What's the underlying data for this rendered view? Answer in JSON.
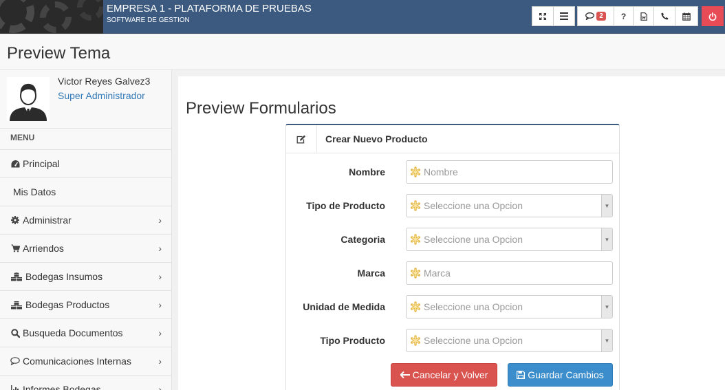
{
  "header": {
    "company_title": "EMPRESA 1 - PLATAFORMA DE PRUEBAS",
    "subtitle": "SOFTWARE DE GESTION",
    "toolbar": {
      "icons": [
        "fullscreen-icon",
        "menu-icon",
        "chat-icon",
        "help-icon",
        "document-icon",
        "phone-icon",
        "calendar-icon",
        "power-icon"
      ],
      "messages_count": "2",
      "help_label": "?"
    }
  },
  "page": {
    "title": "Preview Tema"
  },
  "user": {
    "name": "Victor Reyes Galvez3",
    "role": "Super Administrador"
  },
  "sidebar": {
    "menu_label": "MENU",
    "items": [
      {
        "label": "Principal",
        "icon": "dashboard-icon",
        "has_submenu": false
      },
      {
        "label": "Mis Datos",
        "icon": "",
        "has_submenu": false
      },
      {
        "label": "Administrar",
        "icon": "gear-icon",
        "has_submenu": true
      },
      {
        "label": "Arriendos",
        "icon": "cart-icon",
        "has_submenu": true
      },
      {
        "label": "Bodegas Insumos",
        "icon": "cubes-icon",
        "has_submenu": true
      },
      {
        "label": "Bodegas Productos",
        "icon": "cubes-icon",
        "has_submenu": true
      },
      {
        "label": "Busqueda Documentos",
        "icon": "search-icon",
        "has_submenu": true
      },
      {
        "label": "Comunicaciones Internas",
        "icon": "comment-icon",
        "has_submenu": true
      },
      {
        "label": "Informes Bodegas",
        "icon": "bar-chart-icon",
        "has_submenu": true
      }
    ]
  },
  "main": {
    "section_title": "Preview Formularios",
    "form": {
      "title": "Crear Nuevo Producto",
      "fields": [
        {
          "label": "Nombre",
          "type": "text",
          "placeholder": "Nombre"
        },
        {
          "label": "Tipo de Producto",
          "type": "select",
          "placeholder": "Seleccione una Opcion"
        },
        {
          "label": "Categoria",
          "type": "select",
          "placeholder": "Seleccione una Opcion"
        },
        {
          "label": "Marca",
          "type": "text",
          "placeholder": "Marca"
        },
        {
          "label": "Unidad de Medida",
          "type": "select",
          "placeholder": "Seleccione una Opcion"
        },
        {
          "label": "Tipo Producto",
          "type": "select",
          "placeholder": "Seleccione una Opcion"
        }
      ],
      "cancel_label": "Cancelar y Volver",
      "save_label": "Guardar Cambios"
    }
  },
  "colors": {
    "topbar": "#3c5a80",
    "accent_link": "#337ab7",
    "danger": "#d9534f",
    "primary": "#3c8dcc",
    "power": "#e74c56",
    "required_asterisk": "#e6b84a"
  }
}
